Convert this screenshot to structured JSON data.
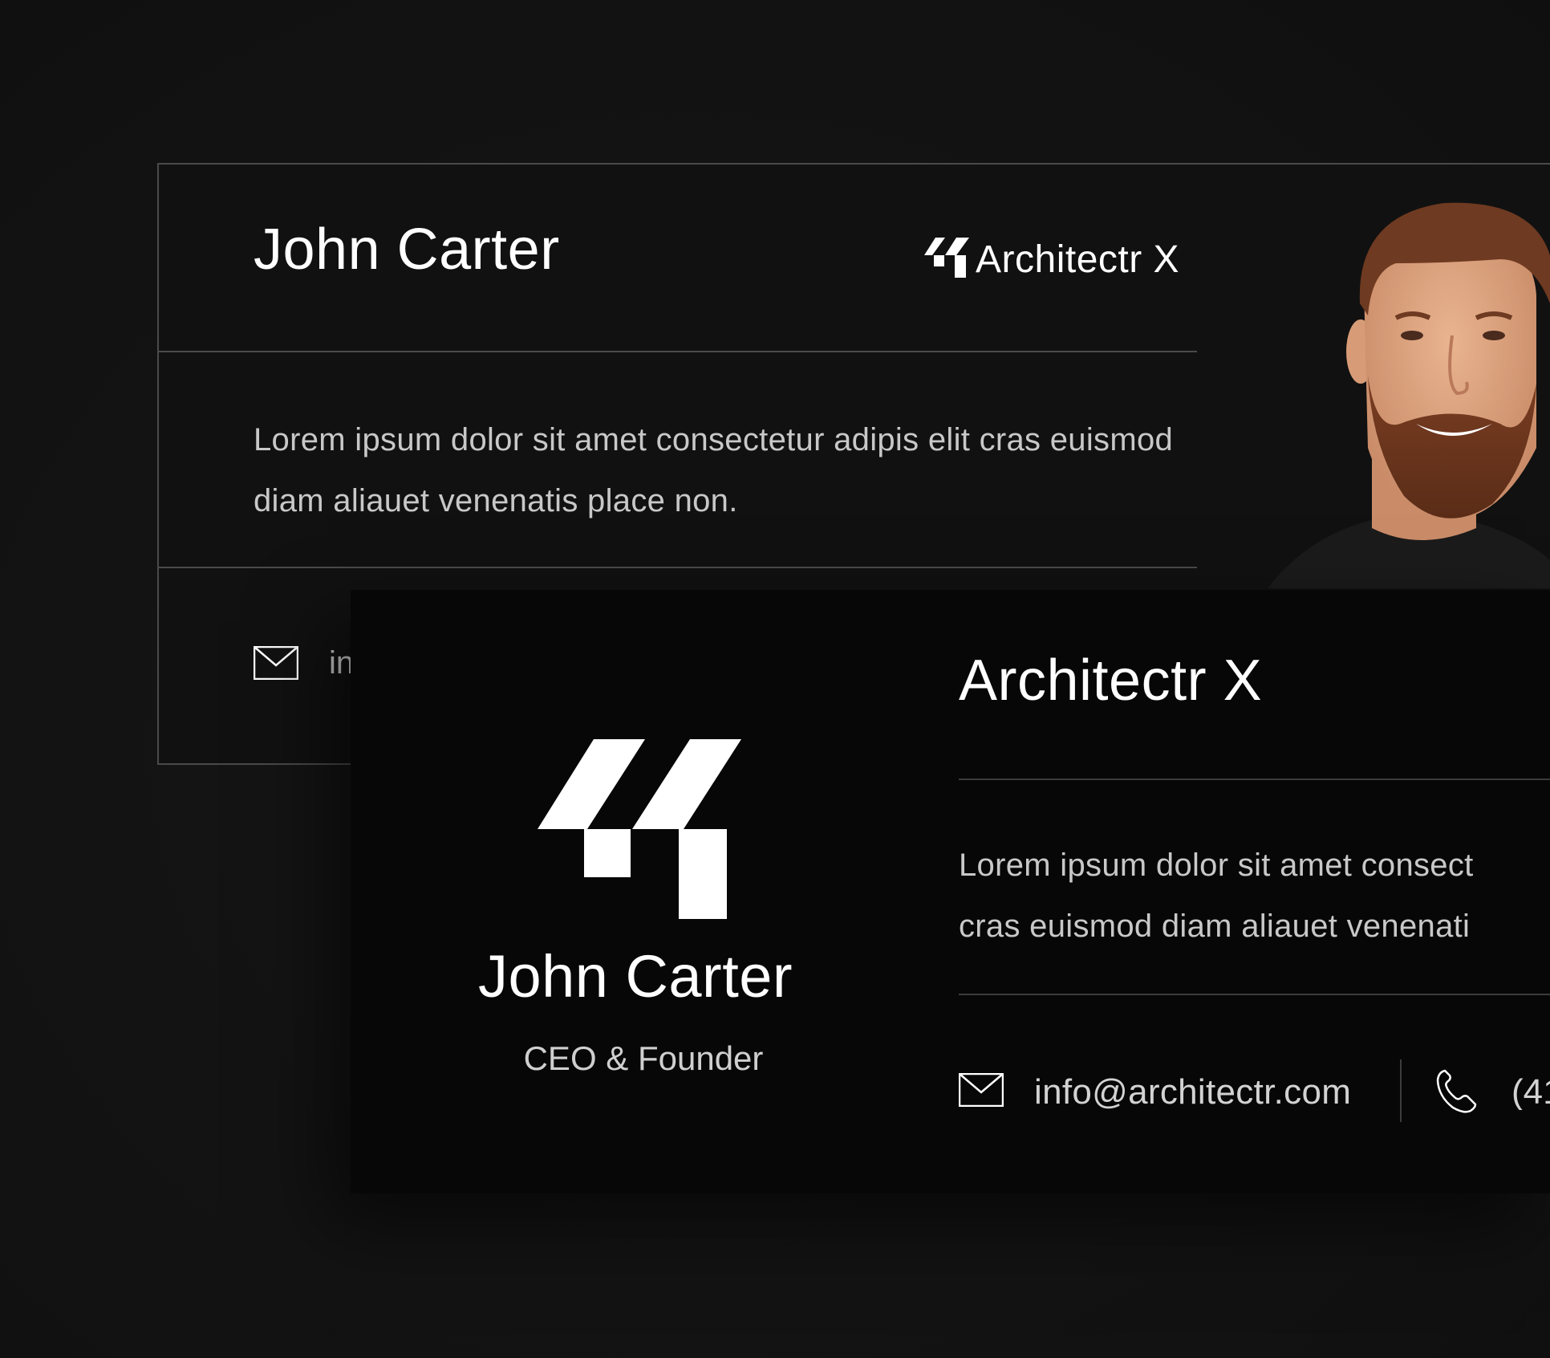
{
  "back_card": {
    "name": "John Carter",
    "brand": "Architectr X",
    "description": "Lorem ipsum dolor sit amet consectetur adipis elit cras euismod diam aliauet venenatis place non.",
    "email_partial": "in",
    "photo_icon": "portrait-photo"
  },
  "front_card": {
    "logo_icon": "architectr-logo-icon",
    "name": "John Carter",
    "role": "CEO & Founder",
    "brand": "Architectr X",
    "description_line1": "Lorem ipsum dolor sit amet consect",
    "description_line2": "cras euismod diam aliauet venenati",
    "email": "info@architectr.com",
    "phone_partial": "(41",
    "email_icon": "mail-icon",
    "phone_icon": "phone-icon"
  },
  "colors": {
    "background": "#141414",
    "front_card_bg": "#070707",
    "back_card_border": "#4a4a4a",
    "text_primary": "#ffffff",
    "text_secondary": "#c8c8c8"
  }
}
